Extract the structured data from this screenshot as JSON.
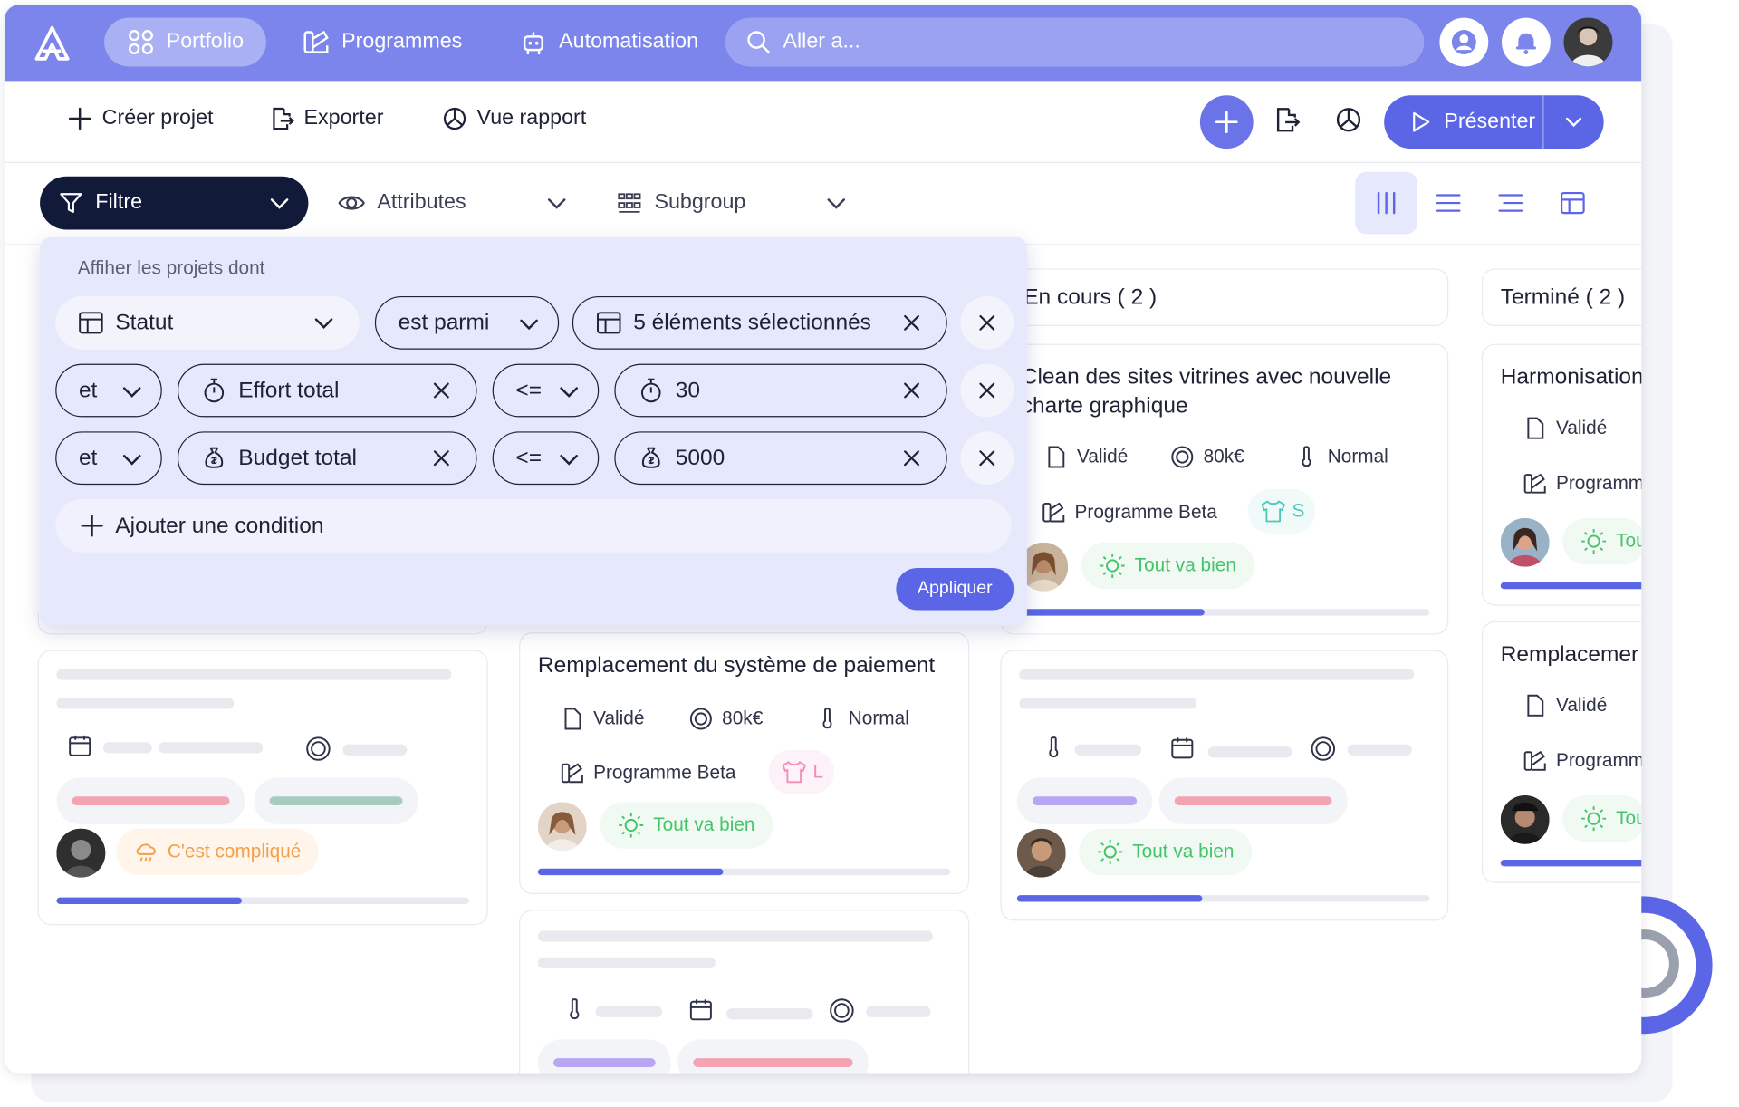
{
  "nav": {
    "portfolio": "Portfolio",
    "programmes": "Programmes",
    "automatisation": "Automatisation",
    "search_placeholder": "Aller a..."
  },
  "toolbar": {
    "create": "Créer projet",
    "export": "Exporter",
    "report": "Vue rapport",
    "present": "Présenter"
  },
  "filterbar": {
    "filter": "Filtre",
    "attributes": "Attributes",
    "subgroup": "Subgroup"
  },
  "filter_panel": {
    "label": "Affiher les projets dont",
    "rows": [
      {
        "field": "Statut",
        "operator": "est parmi",
        "value": "5 éléments sélectionnés"
      },
      {
        "connector": "et",
        "field": "Effort total",
        "operator": "<=",
        "value": "30"
      },
      {
        "connector": "et",
        "field": "Budget total",
        "operator": "<=",
        "value": "5000"
      }
    ],
    "add_condition": "Ajouter une condition",
    "apply": "Appliquer"
  },
  "columns": {
    "en_cours": "En cours ( 2 )",
    "termine": "Terminé ( 2 )"
  },
  "cards": {
    "en_cours_1": {
      "title_line1": "Clean des sites vitrines avec nouvelle",
      "title_line2": "charte graphique",
      "status": "Validé",
      "budget": "80k€",
      "priority": "Normal",
      "programme": "Programme Beta",
      "size": "S",
      "health": "Tout va bien",
      "progress": 0.45
    },
    "middle_1": {
      "title": "Remplacement du système de paiement",
      "status": "Validé",
      "budget": "80k€",
      "priority": "Normal",
      "programme": "Programme Beta",
      "size": "L",
      "health": "Tout va bien",
      "progress": 0.45
    },
    "left_1": {
      "health": "C'est compliqué",
      "progress": 0.45
    },
    "en_cours_2": {
      "health": "Tout va bien",
      "progress": 0.45
    },
    "termine_1": {
      "title": "Harmonisation",
      "status": "Validé",
      "programme": "Programm",
      "health": "Tou"
    },
    "termine_2": {
      "title": "Remplacemer",
      "status": "Validé",
      "programme": "Programm",
      "health": "Tou"
    }
  },
  "colors": {
    "topbar": "#7b85ec",
    "accent": "#5b66e6",
    "filter_button": "#121a3a",
    "health_good": "#45c46a",
    "health_warn": "#f4a04a"
  }
}
